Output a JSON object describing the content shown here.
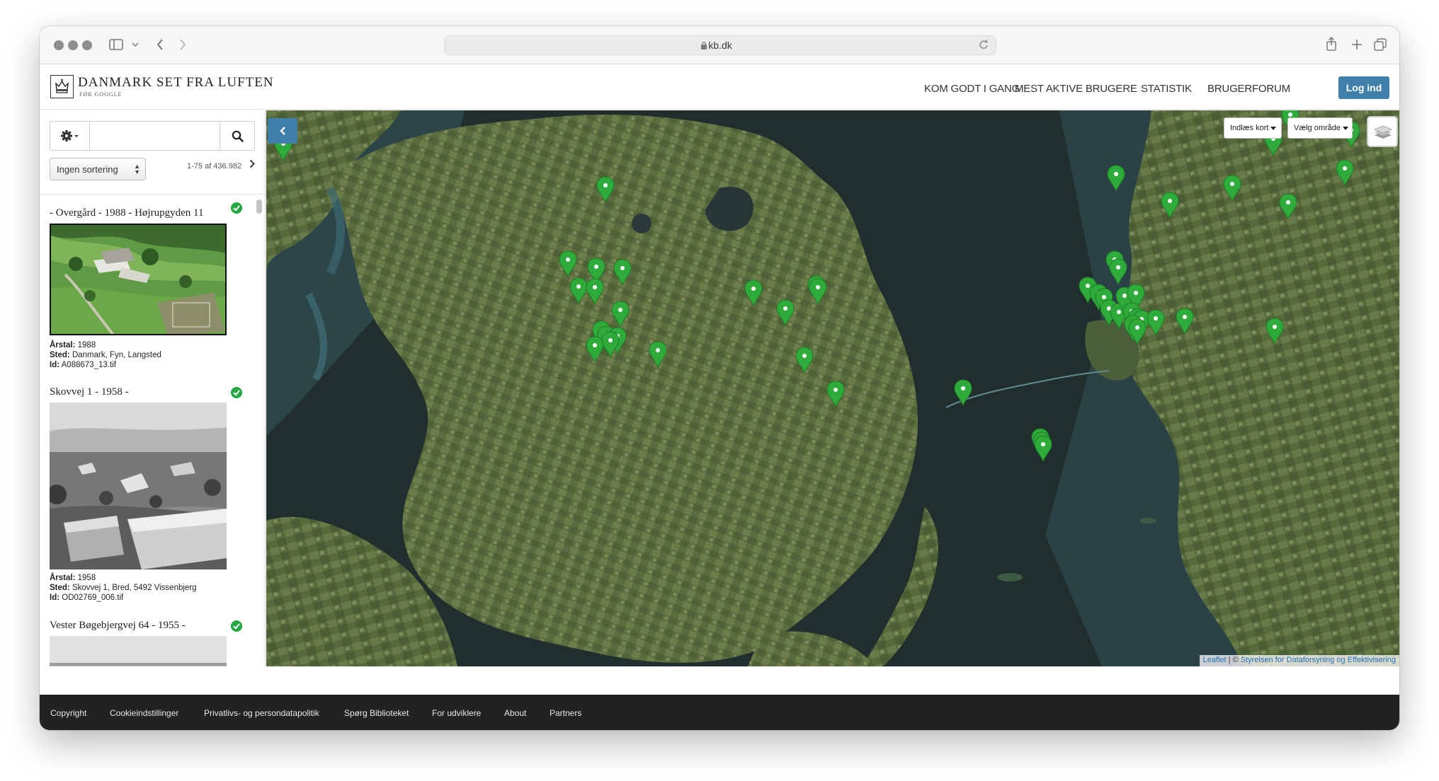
{
  "browser": {
    "url": "kb.dk"
  },
  "header": {
    "logo_title": "DANMARK SET FRA LUFTEN",
    "logo_sub": "FØR GOOGLE",
    "nav": [
      "KOM GODT I GANG",
      "MEST AKTIVE BRUGERE",
      "STATISTIK",
      "BRUGERFORUM"
    ],
    "login_label": "Log ind",
    "login_color": "#3f7fa9"
  },
  "sidebar": {
    "search": {
      "value": "",
      "placeholder": ""
    },
    "sort_label": "Ingen sortering",
    "result_count": "1-75 af 436.982",
    "items": [
      {
        "title": "- Overgård - 1988 - Højrupgyden 11",
        "year_label": "Årstal:",
        "year": "1988",
        "place_label": "Sted:",
        "place": "Danmark, Fyn, Langsted",
        "id_label": "Id:",
        "id": "A088673_13.tif",
        "verified": true
      },
      {
        "title": "Skovvej 1 - 1958 -",
        "year_label": "Årstal:",
        "year": "1958",
        "place_label": "Sted:",
        "place": "Skovvej 1, Bred, 5492 Vissenbjerg",
        "id_label": "Id:",
        "id": "OD02769_006.tif",
        "verified": true
      },
      {
        "title": "Vester Bøgebjergvej 64 - 1955 -",
        "verified": true
      }
    ]
  },
  "map": {
    "load_map_label": "Indlæs kort",
    "choose_area_label": "Vælg område",
    "zoom_in": "+",
    "zoom_out": "−",
    "attribution_leaflet": "Leaflet",
    "attribution_sep": " | © ",
    "attribution_source": "Styrelsen for Dataforsyning og Effektivisering",
    "marker_color": "#2eab3a"
  },
  "footer": {
    "links": [
      "Copyright",
      "Cookieindstillinger",
      "Privatlivs- og persondatapolitik",
      "Spørg Biblioteket",
      "For udviklere",
      "About",
      "Partners"
    ]
  }
}
